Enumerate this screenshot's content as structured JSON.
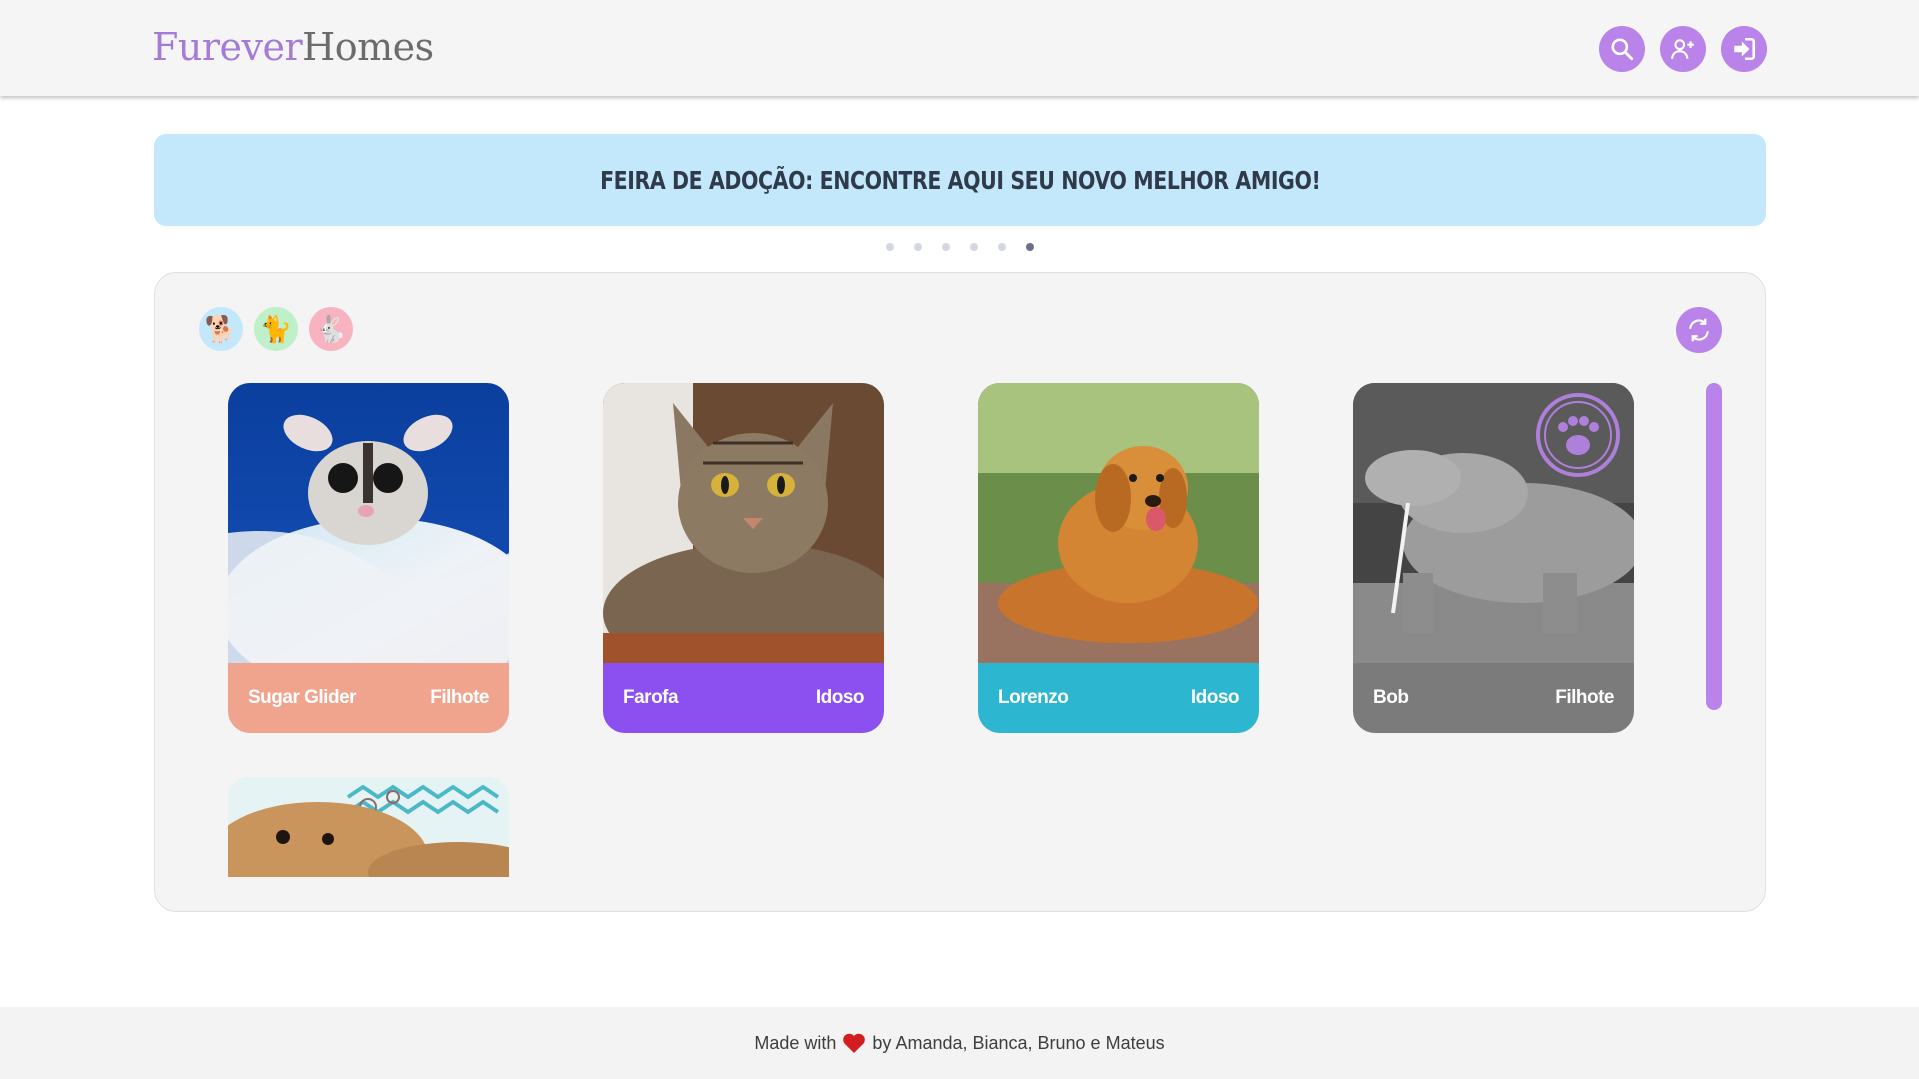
{
  "header": {
    "logo_part1": "Furever",
    "logo_part2": "Homes",
    "icons": [
      "search-icon",
      "add-user-icon",
      "login-icon"
    ]
  },
  "banner": {
    "text": "Feira de adoção: encontre aqui seu novo melhor amigo!",
    "carousel_count": 6,
    "carousel_active": 6
  },
  "filters": [
    {
      "name": "dog",
      "glyph": "🐕"
    },
    {
      "name": "cat",
      "glyph": "🐈"
    },
    {
      "name": "rabbit",
      "glyph": "🐇"
    }
  ],
  "cards": [
    {
      "name": "Sugar Glider",
      "age": "Filhote",
      "color": "#f0a48e",
      "image": "sugar-glider-photo"
    },
    {
      "name": "Farofa",
      "age": "Idoso",
      "color": "#8c4ff0",
      "image": "tabby-cat-photo"
    },
    {
      "name": "Lorenzo",
      "age": "Idoso",
      "color": "#2db6cf",
      "image": "golden-retriever-photo"
    },
    {
      "name": "Bob",
      "age": "Filhote",
      "color": "#7b7b7b",
      "image": "komodo-dragon-photo",
      "adopted_stamp": true
    }
  ],
  "footer": {
    "made_with": "Made with",
    "by": "by Amanda, Bianca, Bruno e Mateus"
  },
  "colors": {
    "accent": "#b983ea",
    "banner_bg": "#c4e8fb",
    "header_bg": "#f5f5f5"
  }
}
